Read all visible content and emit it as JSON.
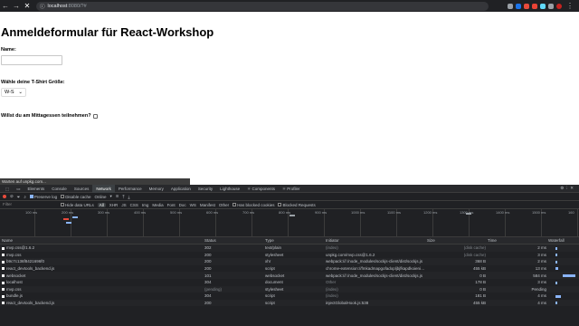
{
  "browser": {
    "url_host": "localhost",
    "url_path": ":8080/?#",
    "status_text": "Warten auf unpkg.com..."
  },
  "page": {
    "title": "Anmeldeformular für React-Workshop",
    "name_label": "Name:",
    "shirt_label": "Wähle deine T-Shirt Größe:",
    "shirt_value": "W-S",
    "lunch_label": "Willst du am Mittagessen teilnehmen?"
  },
  "devtools": {
    "tabs": [
      "Elements",
      "Console",
      "Sources",
      "Network",
      "Performance",
      "Memory",
      "Application",
      "Security",
      "Lighthouse",
      "⚛ Components",
      "⚛ Profiler"
    ],
    "active_tab": 3,
    "preserve_log": "Preserve log",
    "disable_cache": "Disable cache",
    "throttle": "Online",
    "filter_placeholder": "Filter",
    "hide_data_urls": "Hide data URLs",
    "filter_chips": [
      "All",
      "XHR",
      "JS",
      "CSS",
      "Img",
      "Media",
      "Font",
      "Doc",
      "WS",
      "Manifest",
      "Other"
    ],
    "has_blocked": "Has blocked cookies",
    "blocked_requests": "Blocked Requests",
    "ticks": [
      "100 ms",
      "200 ms",
      "300 ms",
      "400 ms",
      "500 ms",
      "600 ms",
      "700 ms",
      "800 ms",
      "900 ms",
      "1000 ms",
      "1100 ms",
      "1200 ms",
      "1300 ms",
      "1400 ms",
      "1500 ms",
      "160"
    ],
    "columns": [
      "Name",
      "Status",
      "Type",
      "Initiator",
      "Size",
      "Time",
      "Waterfall"
    ],
    "rows": [
      {
        "name": "mvp.css@1.6.2",
        "status": "302",
        "type": "text/plain",
        "initiator": "(index)",
        "size": "(disk cache)",
        "time": "2 ms",
        "wf": 2
      },
      {
        "name": "mvp.css",
        "status": "200",
        "type": "stylesheet",
        "initiator": "unpkg.com/mvp.css@1.6.2",
        "size": "(disk cache)",
        "time": "3 ms",
        "wf": 2
      },
      {
        "name": "b9c7c136f8421696f0",
        "status": "200",
        "type": "xhr",
        "initiator": "webpack:///./node_modules/sockjs-client/dist/sockjs.js",
        "size": "368 B",
        "time": "2 ms",
        "wf": 2
      },
      {
        "name": "react_devtools_backend.js",
        "status": "200",
        "type": "script",
        "initiator": "chrome-extension://fmkadmapgofadopljbjfkapdkoienih...",
        "size": "455 kB",
        "time": "13 ms",
        "wf": 3
      },
      {
        "name": "websocket",
        "status": "101",
        "type": "websocket",
        "initiator": "webpack:///./node_modules/sockjs-client/dist/sockjs.js",
        "size": "0 B",
        "time": "584 ms",
        "wf": 14
      },
      {
        "name": "localhost",
        "status": "304",
        "type": "document",
        "initiator": "Other",
        "size": "178 B",
        "time": "3 ms",
        "wf": 2
      },
      {
        "name": "mvp.css",
        "status": "(pending)",
        "type": "stylesheet",
        "initiator": "(index)",
        "size": "0 B",
        "time": "Pending",
        "wf": 0
      },
      {
        "name": "bundle.js",
        "status": "304",
        "type": "script",
        "initiator": "(index)",
        "size": "181 B",
        "time": "4 ms",
        "wf": 6
      },
      {
        "name": "react_devtools_backend.js",
        "status": "200",
        "type": "script",
        "initiator": "injectGlobalHook.js:538",
        "size": "455 kB",
        "time": "4 ms",
        "wf": 2
      }
    ]
  }
}
